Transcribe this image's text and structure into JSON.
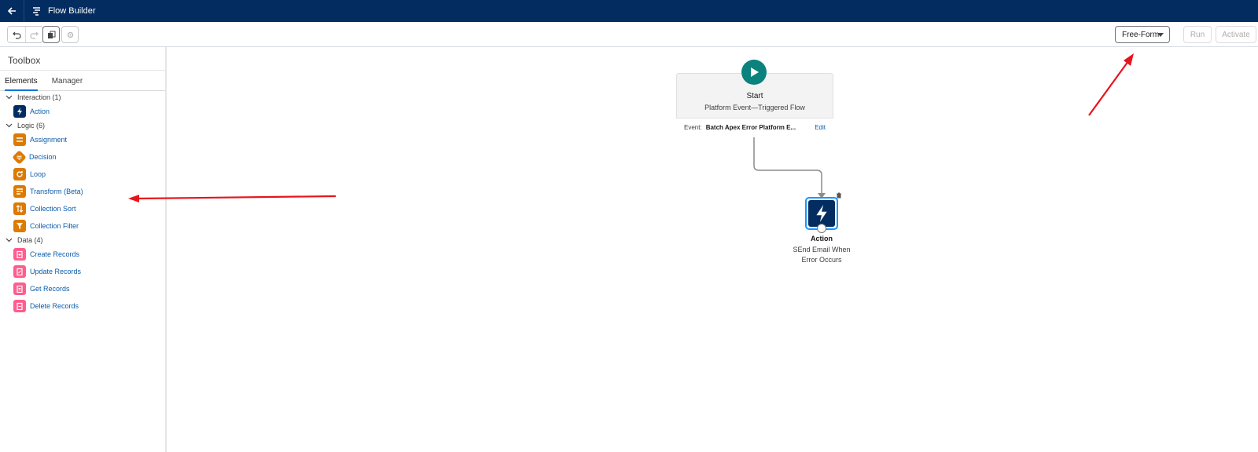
{
  "topbar": {
    "title": "Flow Builder"
  },
  "toolbar": {
    "mode_select": "Free-Form",
    "run_label": "Run",
    "activate_label": "Activate"
  },
  "toolbox": {
    "title": "Toolbox",
    "tabs": [
      "Elements",
      "Manager"
    ],
    "sections": [
      {
        "label": "Interaction (1)",
        "items": [
          {
            "label": "Action",
            "icon": "lightning-icon",
            "color": "#032d60"
          }
        ]
      },
      {
        "label": "Logic (6)",
        "items": [
          {
            "label": "Assignment",
            "icon": "assignment-icon",
            "color": "#dd7a01"
          },
          {
            "label": "Decision",
            "icon": "decision-icon",
            "color": "#dd7a01"
          },
          {
            "label": "Loop",
            "icon": "loop-icon",
            "color": "#dd7a01"
          },
          {
            "label": "Transform (Beta)",
            "icon": "transform-icon",
            "color": "#dd7a01"
          },
          {
            "label": "Collection Sort",
            "icon": "sort-icon",
            "color": "#dd7a01"
          },
          {
            "label": "Collection Filter",
            "icon": "filter-icon",
            "color": "#dd7a01"
          }
        ]
      },
      {
        "label": "Data (4)",
        "items": [
          {
            "label": "Create Records",
            "icon": "create-records-icon",
            "color": "#ff5d8f"
          },
          {
            "label": "Update Records",
            "icon": "update-records-icon",
            "color": "#ff5d8f"
          },
          {
            "label": "Get Records",
            "icon": "get-records-icon",
            "color": "#ff5d8f"
          },
          {
            "label": "Delete Records",
            "icon": "delete-records-icon",
            "color": "#ff5d8f"
          }
        ]
      }
    ]
  },
  "canvas": {
    "start": {
      "title": "Start",
      "subtitle": "Platform Event—Triggered Flow",
      "event_key": "Event:",
      "event_value": "Batch Apex Error Platform E...",
      "edit_label": "Edit"
    },
    "action": {
      "title": "Action",
      "description": "SEnd Email When Error Occurs"
    }
  },
  "colors": {
    "topbar": "#032d60",
    "accent": "#0176d3",
    "annotation_arrow": "#e8141b",
    "start": "#0b827c"
  }
}
